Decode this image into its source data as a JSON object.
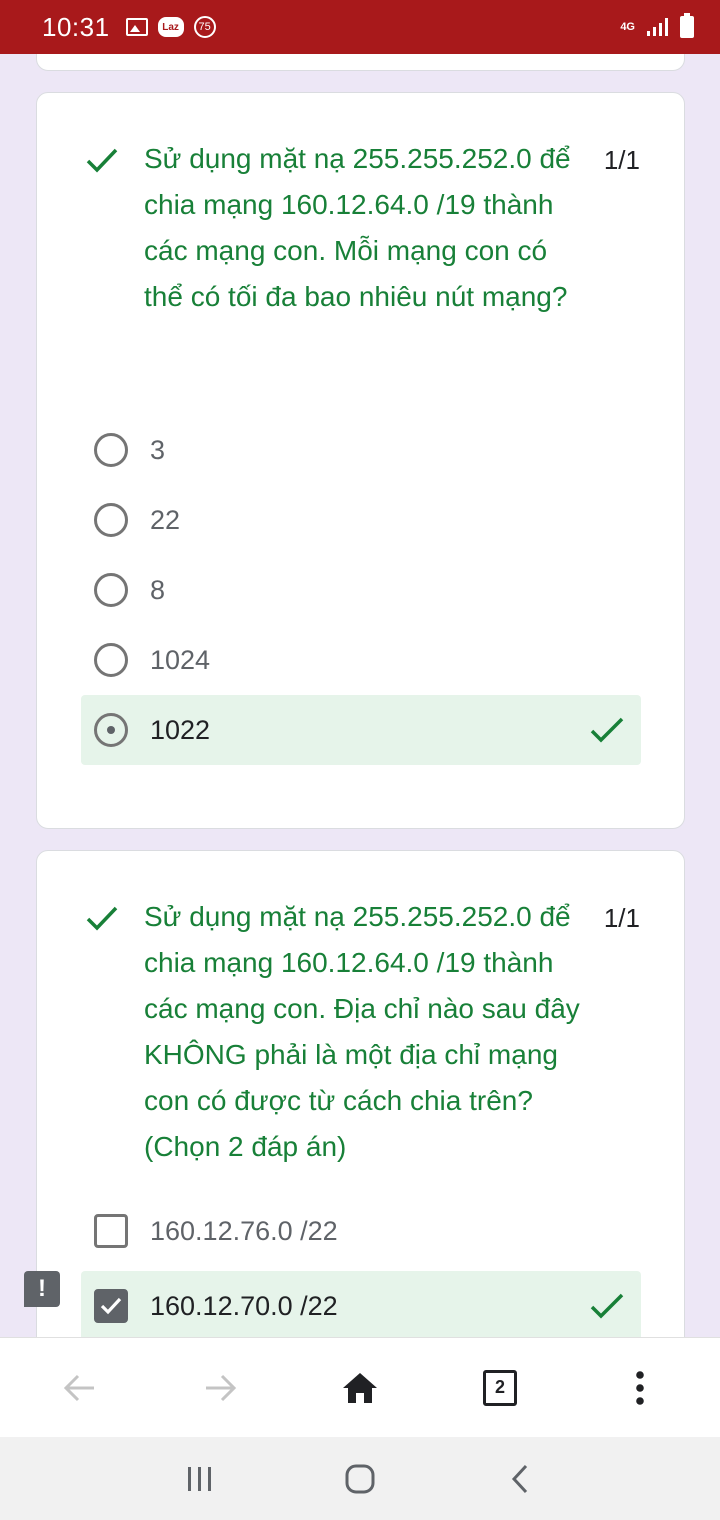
{
  "status_bar": {
    "time": "10:31",
    "laz_label": "Laz",
    "badge_count": "75",
    "network": "4G"
  },
  "questions": [
    {
      "text": "Sử dụng mặt nạ 255.255.252.0 để chia mạng 160.12.64.0 /19 thành các mạng con. Mỗi mạng con có thể có tối đa bao nhiêu nút mạng?",
      "score": "1/1",
      "type": "radio",
      "options": [
        {
          "label": "3",
          "selected": false,
          "correct": false
        },
        {
          "label": "22",
          "selected": false,
          "correct": false
        },
        {
          "label": "8",
          "selected": false,
          "correct": false
        },
        {
          "label": "1024",
          "selected": false,
          "correct": false
        },
        {
          "label": "1022",
          "selected": true,
          "correct": true
        }
      ]
    },
    {
      "text": "Sử dụng mặt nạ 255.255.252.0 để chia mạng 160.12.64.0 /19 thành các mạng con. Địa chỉ nào sau đây KHÔNG phải là một địa chỉ mạng con có được từ cách chia trên?(Chọn 2 đáp án)",
      "score": "1/1",
      "type": "checkbox",
      "options": [
        {
          "label": "160.12.76.0 /22",
          "selected": false,
          "correct": false
        },
        {
          "label": "160.12.70.0 /22",
          "selected": true,
          "correct": true
        }
      ]
    }
  ],
  "feedback_button": "!",
  "browser_bar": {
    "tab_count": "2",
    "icons": [
      "back-arrow-icon",
      "forward-arrow-icon",
      "home-icon",
      "tab-switcher-icon",
      "more-menu-icon"
    ]
  },
  "colors": {
    "status_bar": "#a8191b",
    "correct_green": "#188038",
    "correct_bg": "#e6f4ea",
    "page_bg": "#ede7f6"
  }
}
